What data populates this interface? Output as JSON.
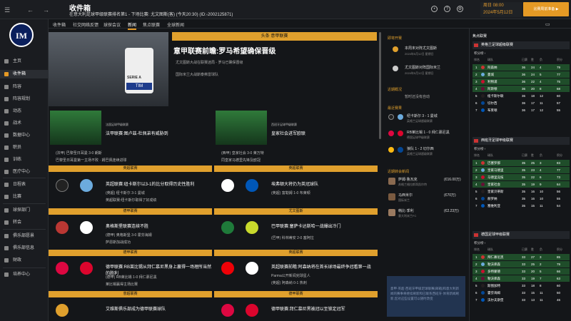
{
  "header": {
    "title": "收件箱",
    "subtitle": "在意大利足球甲级联赛排名第1 - 下场比赛: 尤文图斯(客) (今天20:30) (ID:-2002125871)",
    "date_line1": "周日 08:00",
    "date_line2": "2024年5月12日",
    "continue_label": "比赛周前准备 ▶"
  },
  "tabs": [
    "收件箱",
    "社交网络反馈",
    "球探会议",
    "新闻",
    "焦点联赛",
    "全球新闻"
  ],
  "sidebar": {
    "items": [
      "主页",
      "收件箱",
      "阵容",
      "阵容规划",
      "动态",
      "战术",
      "数据中心",
      "职员",
      "训练",
      "医疗中心",
      "日程表",
      "比赛",
      "球探部门",
      "转会",
      "俱乐部愿景",
      "俱乐部信息",
      "财政",
      "培养中心"
    ]
  },
  "hero": {
    "tag": "头条 意甲联赛",
    "title": "意甲联赛前瞻:罗马希望确保晋级",
    "bullets": [
      "尤文图斯大战在联赛迷局 - 罗马已确保晋级",
      "国际米兰大战斯泰弗雷球队"
    ],
    "ball_text": "SERIE A",
    "tim": "TIM"
  },
  "cards": [
    {
      "badge": "法国足球甲级联赛",
      "title": "法甲联赛:图卢兹-杜佩弟有威胁到",
      "bullets": [
        "(法甲) 巴黎圣日耳曼 3-0 朗斯",
        "巴黎圣日耳曼第一主场不败 · 姆巴佩连续进球"
      ]
    },
    {
      "badge": "西班牙足球甲级联赛",
      "title": "皇家社会进军欧联",
      "bullets": [
        "(西甲) 皇家社会 3-0 莱万特",
        "同皇家马德里先锋及欧冠"
      ]
    }
  ],
  "stories": [
    {
      "bar": "英超联赛",
      "title": "英超联赛:纽卡斯尔以3-1的比分取得历史性胜利",
      "bullets": [
        "(英超) 纽卡斯尔 3-1 曼城",
        "英超联赛:纽卡斯尔取得了好成绩"
      ]
    },
    {
      "bar": "英超联赛",
      "title": "埃弗顿大将仍为英冠球队",
      "bullets": [
        "(英超) 富勒姆 1-0 布莱顿"
      ]
    },
    {
      "bar": "德甲联赛",
      "title": "奥格斯堡联赛连续不胜",
      "bullets": [
        "(德甲) 奥格斯堡 3-0 霍芬海姆",
        "萨恩斯加战成功"
      ]
    },
    {
      "bar": "尤文图斯",
      "title": "巴甲联赛:塞萨卡达斯哈一战爆出冷门",
      "bullets": [
        "(巴甲) 科林蒂安 2-0 塞阿拉"
      ]
    },
    {
      "bar": "德甲联赛",
      "title": "德甲联赛:RB莱比锡从拜仁慕尼黑身上赢得一场理所当然的胜利",
      "bullets": [
        "(德甲) RB莱比锡 1-0 拜仁慕尼黑",
        "莱比锡赢得主场比赛"
      ]
    },
    {
      "bar": "英超联赛",
      "title": "英超联赛前瞻:阿森纳将在首长球场最终争冠看第一战",
      "bullets": [
        "Parma公开新闻完球星人",
        "(英超) 阿森纳 0-1 热刺"
      ]
    },
    {
      "bar": "意超联赛",
      "title": "艾维斯俱乐部成为德甲联赛球队",
      "bullets": []
    },
    {
      "bar": "德甲联赛",
      "title": "德甲联赛:拜仁慕尼黑被冠以至锁定冠军",
      "bullets": []
    }
  ],
  "middle": {
    "upcoming_title": "即将开赛",
    "upcoming": [
      {
        "text": "本周末对阵尤文图斯",
        "date": "2024年5月12日 星期日"
      },
      {
        "text": "尤文图斯对阵国际米兰",
        "date": "2024年5月12日 星期日"
      }
    ],
    "transfer_title": "近期概况",
    "transfer_empty": "暂时还没有自动",
    "recent_title": "最近赛果",
    "results": [
      {
        "text": "纽卡斯尔 3 - 1 曼城",
        "sub": "英格兰足球超级联赛"
      },
      {
        "text": "RB莱比锡 1 - 0 拜仁慕尼黑",
        "sub": "德国足球甲级联赛"
      },
      {
        "text": "狼队 1 - 2 切尔西",
        "sub": "英格兰足球超级联赛"
      }
    ],
    "transfers_title": "近期转会新闻",
    "transfers": [
      {
        "name": "萨姆·鲁瓦克",
        "club": "苏格兰格拉斯哥凯尔特",
        "fee": "(€16.00万)"
      },
      {
        "name": "马西米尔",
        "club": "国际米兰",
        "fee": "(€70万)"
      },
      {
        "name": "韩比·季利",
        "club": "意大利米兰FC",
        "fee": "(€2.23万)"
      }
    ],
    "notice": "意甲·英超·西班牙甲级足球联赛(邮箱)和意大利新闻的赛事将继续刷新和已联系西班牙·体育新闻刷新,您对这些设置可以随时改变"
  },
  "right": {
    "title": "焦点联赛",
    "leagues": [
      {
        "name": "英格兰足球超级联赛",
        "sub": "积分榜 ›",
        "rows": [
          [
            "1",
            "阿森纳",
            "36",
            "24",
            "4",
            "79"
          ],
          [
            "2",
            "曼城",
            "36",
            "24",
            "5",
            "77"
          ],
          [
            "3",
            "利物浦",
            "36",
            "22",
            "4",
            "75"
          ],
          [
            "4",
            "阿斯顿",
            "36",
            "20",
            "8",
            "68"
          ],
          [
            "5",
            "纽卡斯尔联",
            "36",
            "18",
            "12",
            "60"
          ],
          [
            "6",
            "切尔西",
            "36",
            "17",
            "11",
            "57"
          ],
          [
            "7",
            "布莱顿",
            "36",
            "17",
            "12",
            "55"
          ]
        ]
      },
      {
        "name": "西班牙足球甲级联赛",
        "sub": "积分榜 ›",
        "rows": [
          [
            "1",
            "巴塞罗那",
            "35",
            "25",
            "3",
            "83"
          ],
          [
            "2",
            "皇家马德里",
            "35",
            "23",
            "4",
            "77"
          ],
          [
            "3",
            "马德里竞技",
            "35",
            "22",
            "6",
            "73"
          ],
          [
            "4",
            "皇家社会",
            "35",
            "19",
            "9",
            "64"
          ],
          [
            "5",
            "皇家贝蒂斯",
            "35",
            "16",
            "10",
            "56"
          ],
          [
            "6",
            "赫罗纳",
            "35",
            "16",
            "10",
            "55"
          ],
          [
            "7",
            "塞维利亚",
            "35",
            "15",
            "11",
            "54"
          ]
        ]
      },
      {
        "name": "德国足球甲级联赛",
        "sub": "积分榜 ›",
        "rows": [
          [
            "1",
            "拜仁慕尼黑",
            "33",
            "27",
            "3",
            "85"
          ],
          [
            "2",
            "勒沃库森",
            "33",
            "25",
            "2",
            "79"
          ],
          [
            "3",
            "多特蒙德",
            "33",
            "20",
            "5",
            "66"
          ],
          [
            "4",
            "勒沃库森",
            "33",
            "19",
            "7",
            "63"
          ],
          [
            "5",
            "斯图加特",
            "33",
            "18",
            "8",
            "60"
          ],
          [
            "6",
            "霍芬海姆",
            "33",
            "15",
            "11",
            "50"
          ],
          [
            "7",
            "沃尔夫斯堡",
            "33",
            "13",
            "11",
            "46"
          ]
        ]
      }
    ],
    "cols": [
      "排名",
      "球队",
      "已赛",
      "胜",
      "负",
      "积分"
    ]
  }
}
